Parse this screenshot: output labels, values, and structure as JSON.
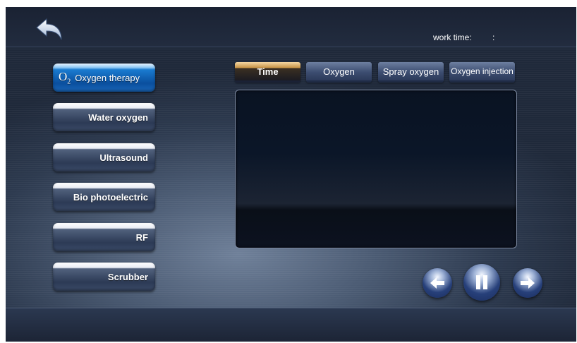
{
  "header": {
    "work_time_label": "work time:",
    "work_time_value": ":"
  },
  "sidebar": {
    "items": [
      {
        "label": "Oxygen therapy",
        "active": true,
        "icon_text": "O",
        "icon_sub": "2"
      },
      {
        "label": "Water oxygen",
        "active": false
      },
      {
        "label": "Ultrasound",
        "active": false
      },
      {
        "label": "Bio photoelectric",
        "active": false
      },
      {
        "label": "RF",
        "active": false
      },
      {
        "label": "Scrubber",
        "active": false
      }
    ]
  },
  "tabs": [
    {
      "label": "Time",
      "active": true
    },
    {
      "label": "Oxygen",
      "active": false
    },
    {
      "label": "Spray oxygen",
      "active": false
    },
    {
      "label": "Oxygen injection",
      "active": false
    }
  ],
  "controls": {
    "prev_icon": "arrow-left-icon",
    "pause_icon": "pause-icon",
    "next_icon": "arrow-right-icon"
  },
  "colors": {
    "active_sidebar": "#0a4f9e",
    "active_tab": "#c89548",
    "background": "#4a5a72"
  }
}
